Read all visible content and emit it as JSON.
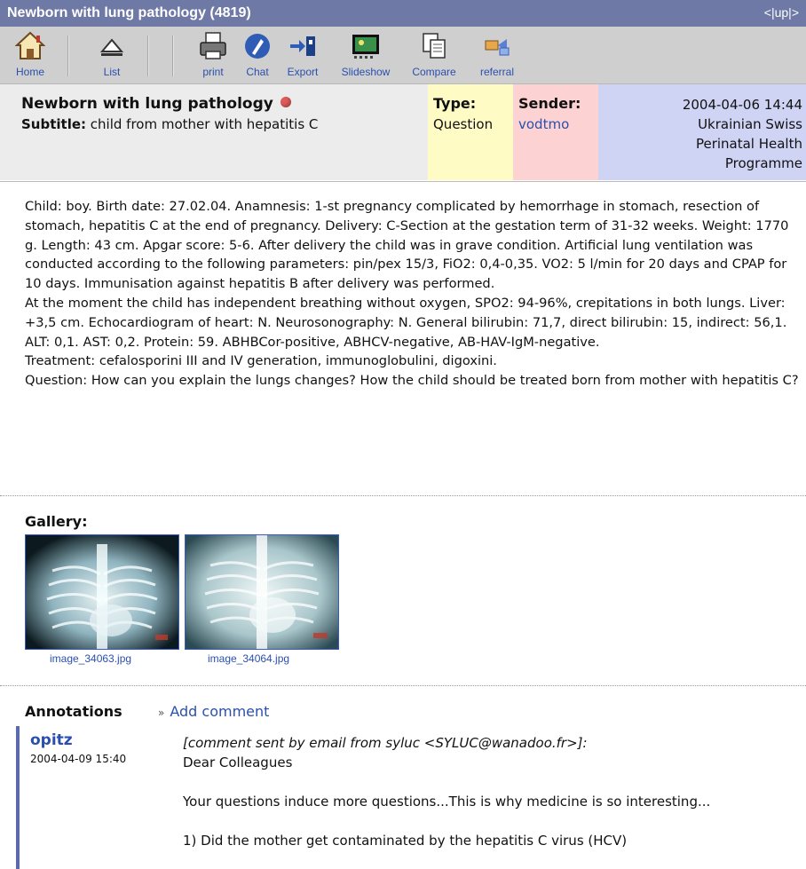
{
  "titlebar": {
    "title": "Newborn with lung pathology (4819)",
    "nav_prev": "<",
    "nav_sep1": "|",
    "nav_up": "up",
    "nav_sep2": "|",
    "nav_next": ">"
  },
  "toolbar": {
    "home": "Home",
    "list": "List",
    "print": "print",
    "chat": "Chat",
    "export": "Export",
    "slideshow": "Slideshow",
    "compare": "Compare",
    "referral": "referral"
  },
  "header": {
    "title": "Newborn with lung pathology",
    "subtitle_label": "Subtitle:",
    "subtitle": "child from mother with hepatitis C",
    "type_label": "Type:",
    "type_value": "Question",
    "sender_label": "Sender:",
    "sender_value": "vodtmo",
    "datetime": "2004-04-06 14:44",
    "org_line1": "Ukrainian Swiss",
    "org_line2": "Perinatal Health",
    "org_line3": "Programme"
  },
  "case_text": "Child: boy. Birth date: 27.02.04. Anamnesis: 1-st pregnancy complicated by hemorrhage in stomach, resection of stomach, hepatitis C at the end of pregnancy. Delivery: C-Section at the gestation term of 31-32 weeks. Weight: 1770 g. Length: 43 cm. Apgar score: 5-6. After delivery the child was in grave condition. Artificial lung ventilation was conducted according to the following parameters: pin/pex 15/3, FiO2: 0,4-0,35. VO2: 5 l/min for 20 days and CPAP for 10 days. Immunisation against hepatitis B after delivery was performed.\nAt the moment the child has independent breathing without oxygen, SPO2: 94-96%, crepitations in both lungs. Liver: +3,5 cm. Echocardiogram of heart: N. Neurosonography: N. General bilirubin: 71,7, direct bilirubin: 15, indirect: 56,1. ALT: 0,1. AST: 0,2. Protein: 59. ABHBCor-positive, ABHCV-negative, AB-HAV-IgM-negative.\nTreatment: cefalosporini III and IV generation, immunoglobulini, digoxini.\nQuestion: How can you explain the lungs changes? How the child should be treated born from mother with hepatitis C?",
  "gallery": {
    "title": "Gallery:",
    "images": [
      {
        "caption": "image_34063.jpg"
      },
      {
        "caption": "image_34064.jpg"
      }
    ]
  },
  "annotations": {
    "title": "Annotations",
    "add_mark": "»",
    "add_label": "Add comment",
    "comment": {
      "author": "opitz",
      "date": "2004-04-09 15:40",
      "email_note": "[comment sent by email from syluc <SYLUC@wanadoo.fr>]:",
      "body": "Dear Colleagues\n\nYour questions induce more questions...This is why medicine is so interesting...\n\n1) Did the mother get contaminated by the hepatitis C virus (HCV)"
    }
  },
  "colors": {
    "titlebar": "#6f79a6",
    "link": "#2a4fae",
    "type_bg": "#fefbc4",
    "sender_bg": "#fcd2d2",
    "date_bg": "#cfd4f5"
  }
}
